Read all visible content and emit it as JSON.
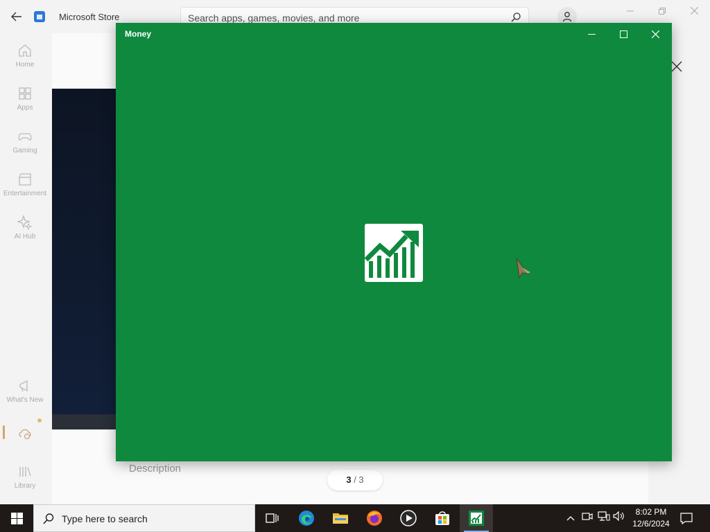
{
  "store": {
    "title": "Microsoft Store",
    "search_placeholder": "Search apps, games, movies, and more",
    "nav": [
      {
        "label": "Home"
      },
      {
        "label": "Apps"
      },
      {
        "label": "Gaming"
      },
      {
        "label": "Entertainment"
      },
      {
        "label": "AI Hub"
      },
      {
        "label": "What's New"
      },
      {
        "label": ""
      },
      {
        "label": "Library"
      }
    ],
    "description_heading": "Description",
    "pager": {
      "current": "3",
      "separator": " / ",
      "total": "3"
    }
  },
  "money_window": {
    "title": "Money",
    "background_color": "#0f893e"
  },
  "taskbar": {
    "search_placeholder": "Type here to search",
    "apps": [
      "Task View",
      "Microsoft Edge",
      "File Explorer",
      "Firefox",
      "Media Player",
      "Microsoft Store",
      "Money"
    ],
    "clock_time": "8:02 PM",
    "clock_date": "12/6/2024"
  }
}
